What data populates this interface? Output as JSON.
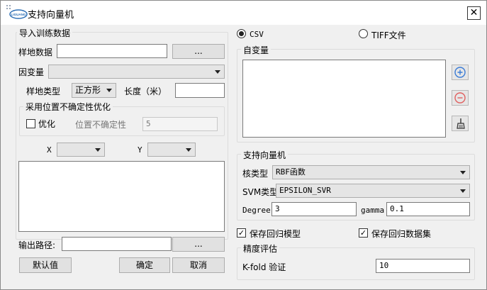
{
  "window": {
    "title": "支持向量机",
    "close_glyph": "✕",
    "logo_text": "LIGUANG"
  },
  "train": {
    "group_label": "导入训练数据",
    "plot_data_label": "样地数据",
    "plot_data_value": "",
    "browse_label": "...",
    "dependent_label": "因变量",
    "dependent_value": "",
    "plot_type_label": "样地类型",
    "plot_type_value": "正方形",
    "length_label": "长度（米）",
    "length_value": "",
    "uncertainty": {
      "group_label": "采用位置不确定性优化",
      "optimize_label": "优化",
      "optimize_checked": false,
      "position_label": "位置不确定性",
      "position_value": "5"
    },
    "x_label": "X",
    "y_label": "Y",
    "output_label": "输出路径:",
    "output_value": "",
    "output_browse_label": "..."
  },
  "buttons": {
    "default_label": "默认值",
    "ok_label": "确定",
    "cancel_label": "取消"
  },
  "format": {
    "csv_label": "CSV",
    "csv_selected": true,
    "tiff_label": "TIFF文件",
    "tiff_selected": false
  },
  "independent": {
    "group_label": "自变量",
    "add_icon": "plus-circle",
    "remove_icon": "minus-circle",
    "clear_icon": "broom"
  },
  "svm": {
    "group_label": "支持向量机",
    "kernel_label": "核类型",
    "kernel_value": "RBF函数",
    "svm_type_label": "SVM类型",
    "svm_type_value": "EPSILON_SVR",
    "degree_label": "Degree",
    "degree_value": "3",
    "gamma_label": "gamma",
    "gamma_value": "0.1"
  },
  "save": {
    "model_label": "保存回归模型",
    "model_checked": true,
    "dataset_label": "保存回归数据集",
    "dataset_checked": true
  },
  "accuracy": {
    "group_label": "精度评估",
    "kfold_label": "K-fold 验证",
    "kfold_value": "10"
  },
  "colors": {
    "accent_blue": "#3a7bd5",
    "remove_red": "#e06060"
  }
}
